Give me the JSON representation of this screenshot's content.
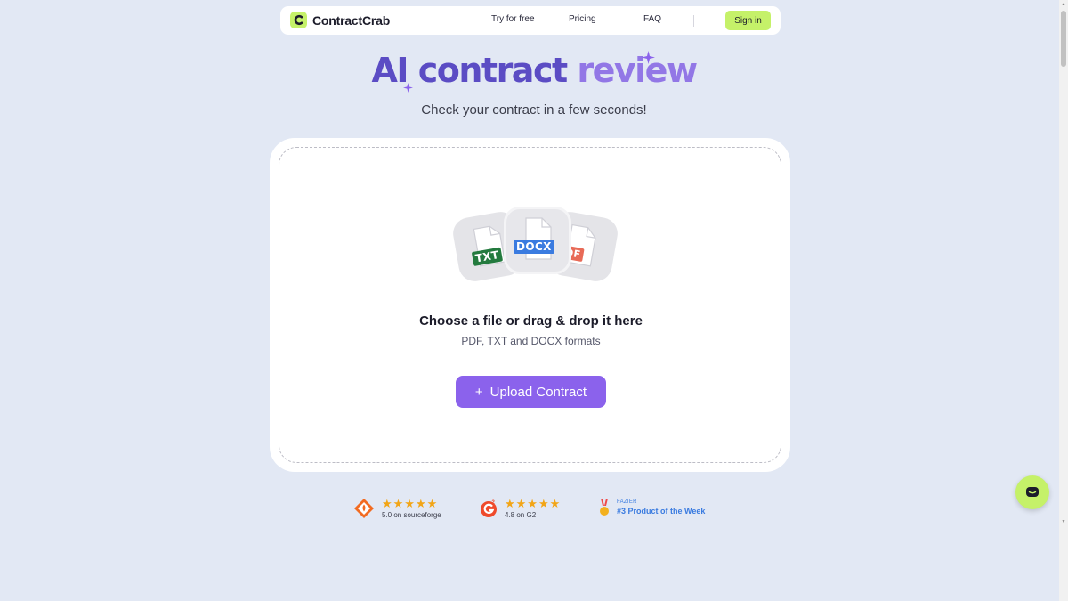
{
  "navbar": {
    "brand_name": "ContractCrab",
    "links": [
      "Try for free",
      "Pricing",
      "FAQ"
    ],
    "signin_label": "Sign in"
  },
  "hero": {
    "title_part1": "AI contract",
    "title_part2": "review",
    "subtitle": "Check your contract in a few seconds!"
  },
  "upload": {
    "file_badges": [
      "TXT",
      "DOCX",
      "PDF"
    ],
    "title": "Choose a file or drag & drop it here",
    "formats": "PDF, TXT and DOCX formats",
    "button_plus": "+",
    "button_label": "Upload Contract"
  },
  "ratings": [
    {
      "score": "5.0 on sourceforge",
      "stars": "★★★★★"
    },
    {
      "score": "4.8 on G2",
      "stars": "★★★★★"
    },
    {
      "label_small": "FAZIER",
      "label_big": "#3 Product of the Week"
    }
  ],
  "colors": {
    "background": "#e2e8f4",
    "accent_lime": "#c5f169",
    "accent_purple": "#8b62ec",
    "title_dark_purple": "#5b4cc4",
    "title_light_purple": "#9277e6"
  }
}
